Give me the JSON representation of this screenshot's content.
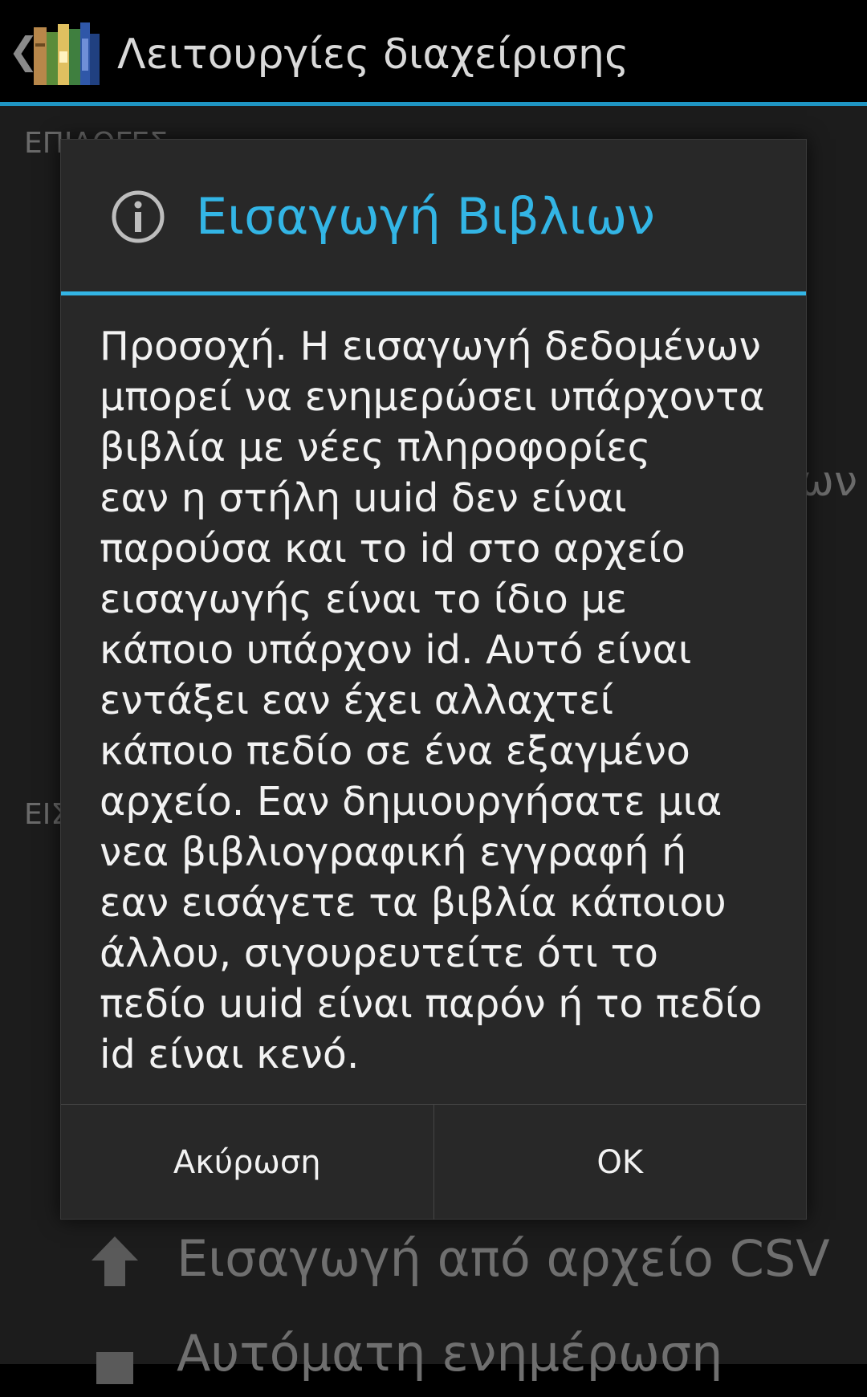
{
  "action_bar": {
    "up_caret": "❮",
    "title": "Λειτουργίες διαχείρισης"
  },
  "background": {
    "section_1": "ΕΠΙΛΟΓΕΣ",
    "right_fragment": "ων",
    "section_2": "ΕΙΣ",
    "items": [
      {
        "label": "Εισαγωγή από αρχείο CSV",
        "icon": "import-icon"
      },
      {
        "label": "Αυτόματη ενημέρωση",
        "icon": "update-icon"
      }
    ]
  },
  "dialog": {
    "icon": "info-icon",
    "title": "Εισαγωγή Βιβλιων",
    "message_lines": [
      "Προσοχή. Η εισαγωγή δεδομένων",
      "μπορεί να ενημερώσει υπάρχοντα",
      "βιβλία με νέες πληροφορίες",
      "εαν η στήλη uuid δεν είναι",
      "παρούσα και το id στο αρχείο",
      "εισαγωγής είναι το ίδιο με",
      "κάποιο υπάρχον id. Αυτό είναι",
      "εντάξει εαν έχει αλλαχτεί",
      "κάποιο πεδίο σε ένα εξαγμένο",
      "αρχείο. Εαν δημιουργήσατε μια",
      "νεα βιβλιογραφική εγγραφή ή",
      "εαν εισάγετε τα βιβλία κάποιου",
      "άλλου, σιγουρευτείτε ότι το",
      "πεδίο uuid είναι παρόν ή το πεδίο",
      "id είναι κενό."
    ],
    "cancel_label": "Ακύρωση",
    "ok_label": "OK"
  },
  "colors": {
    "accent": "#33b5e5",
    "action_bar_divider": "#1f95c3",
    "dialog_bg": "#282828"
  }
}
